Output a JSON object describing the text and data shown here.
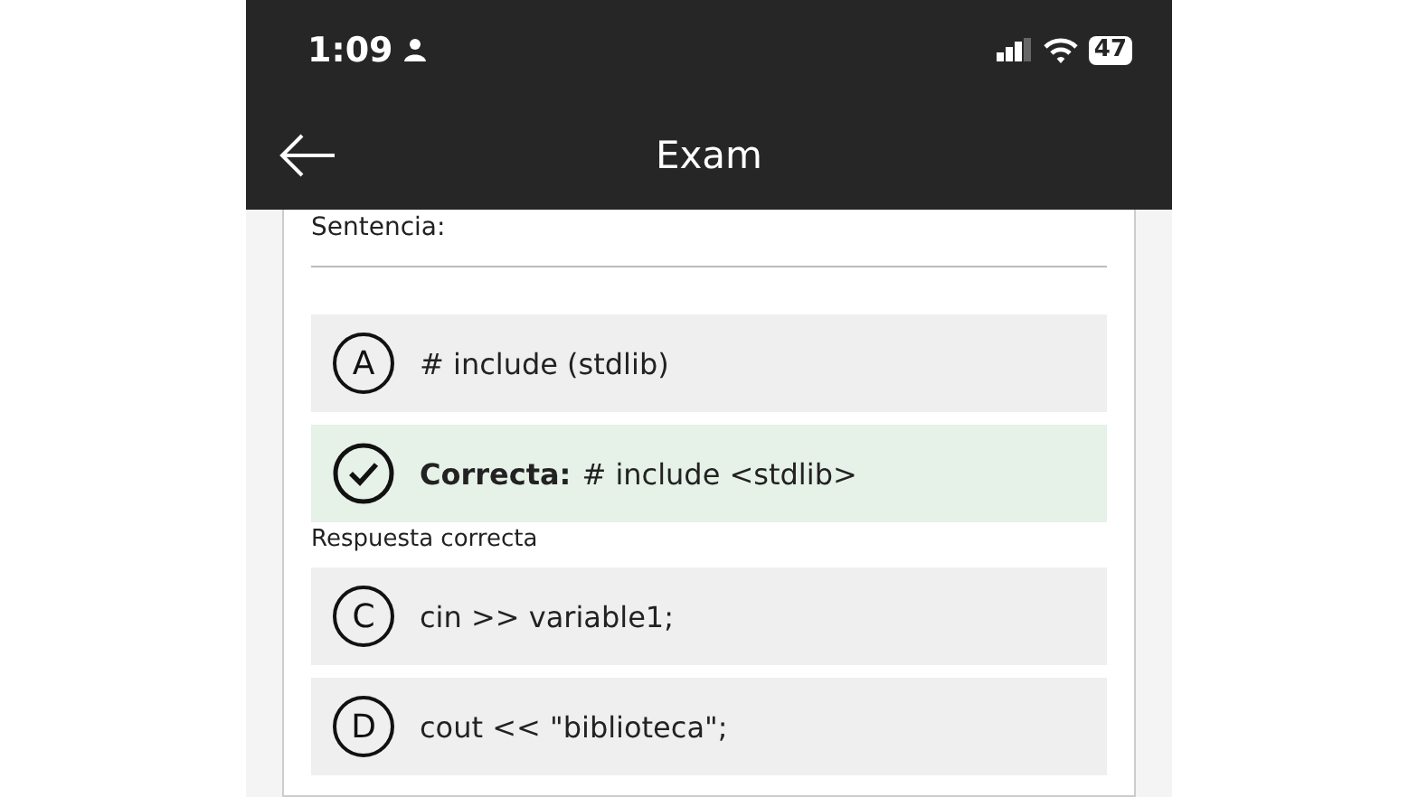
{
  "status_bar": {
    "time": "1:09",
    "battery": "47"
  },
  "header": {
    "title": "Exam"
  },
  "question": {
    "prompt": "Sentencia:"
  },
  "options": [
    {
      "letter": "A",
      "text": "# include (stdlib)",
      "correct": false
    },
    {
      "prefix": "Correcta:",
      "text": "# include <stdlib>",
      "correct": true,
      "note": "Respuesta correcta"
    },
    {
      "letter": "C",
      "text": "cin >> variable1;",
      "correct": false
    },
    {
      "letter": "D",
      "text": "cout << \"biblioteca\";",
      "correct": false
    }
  ]
}
